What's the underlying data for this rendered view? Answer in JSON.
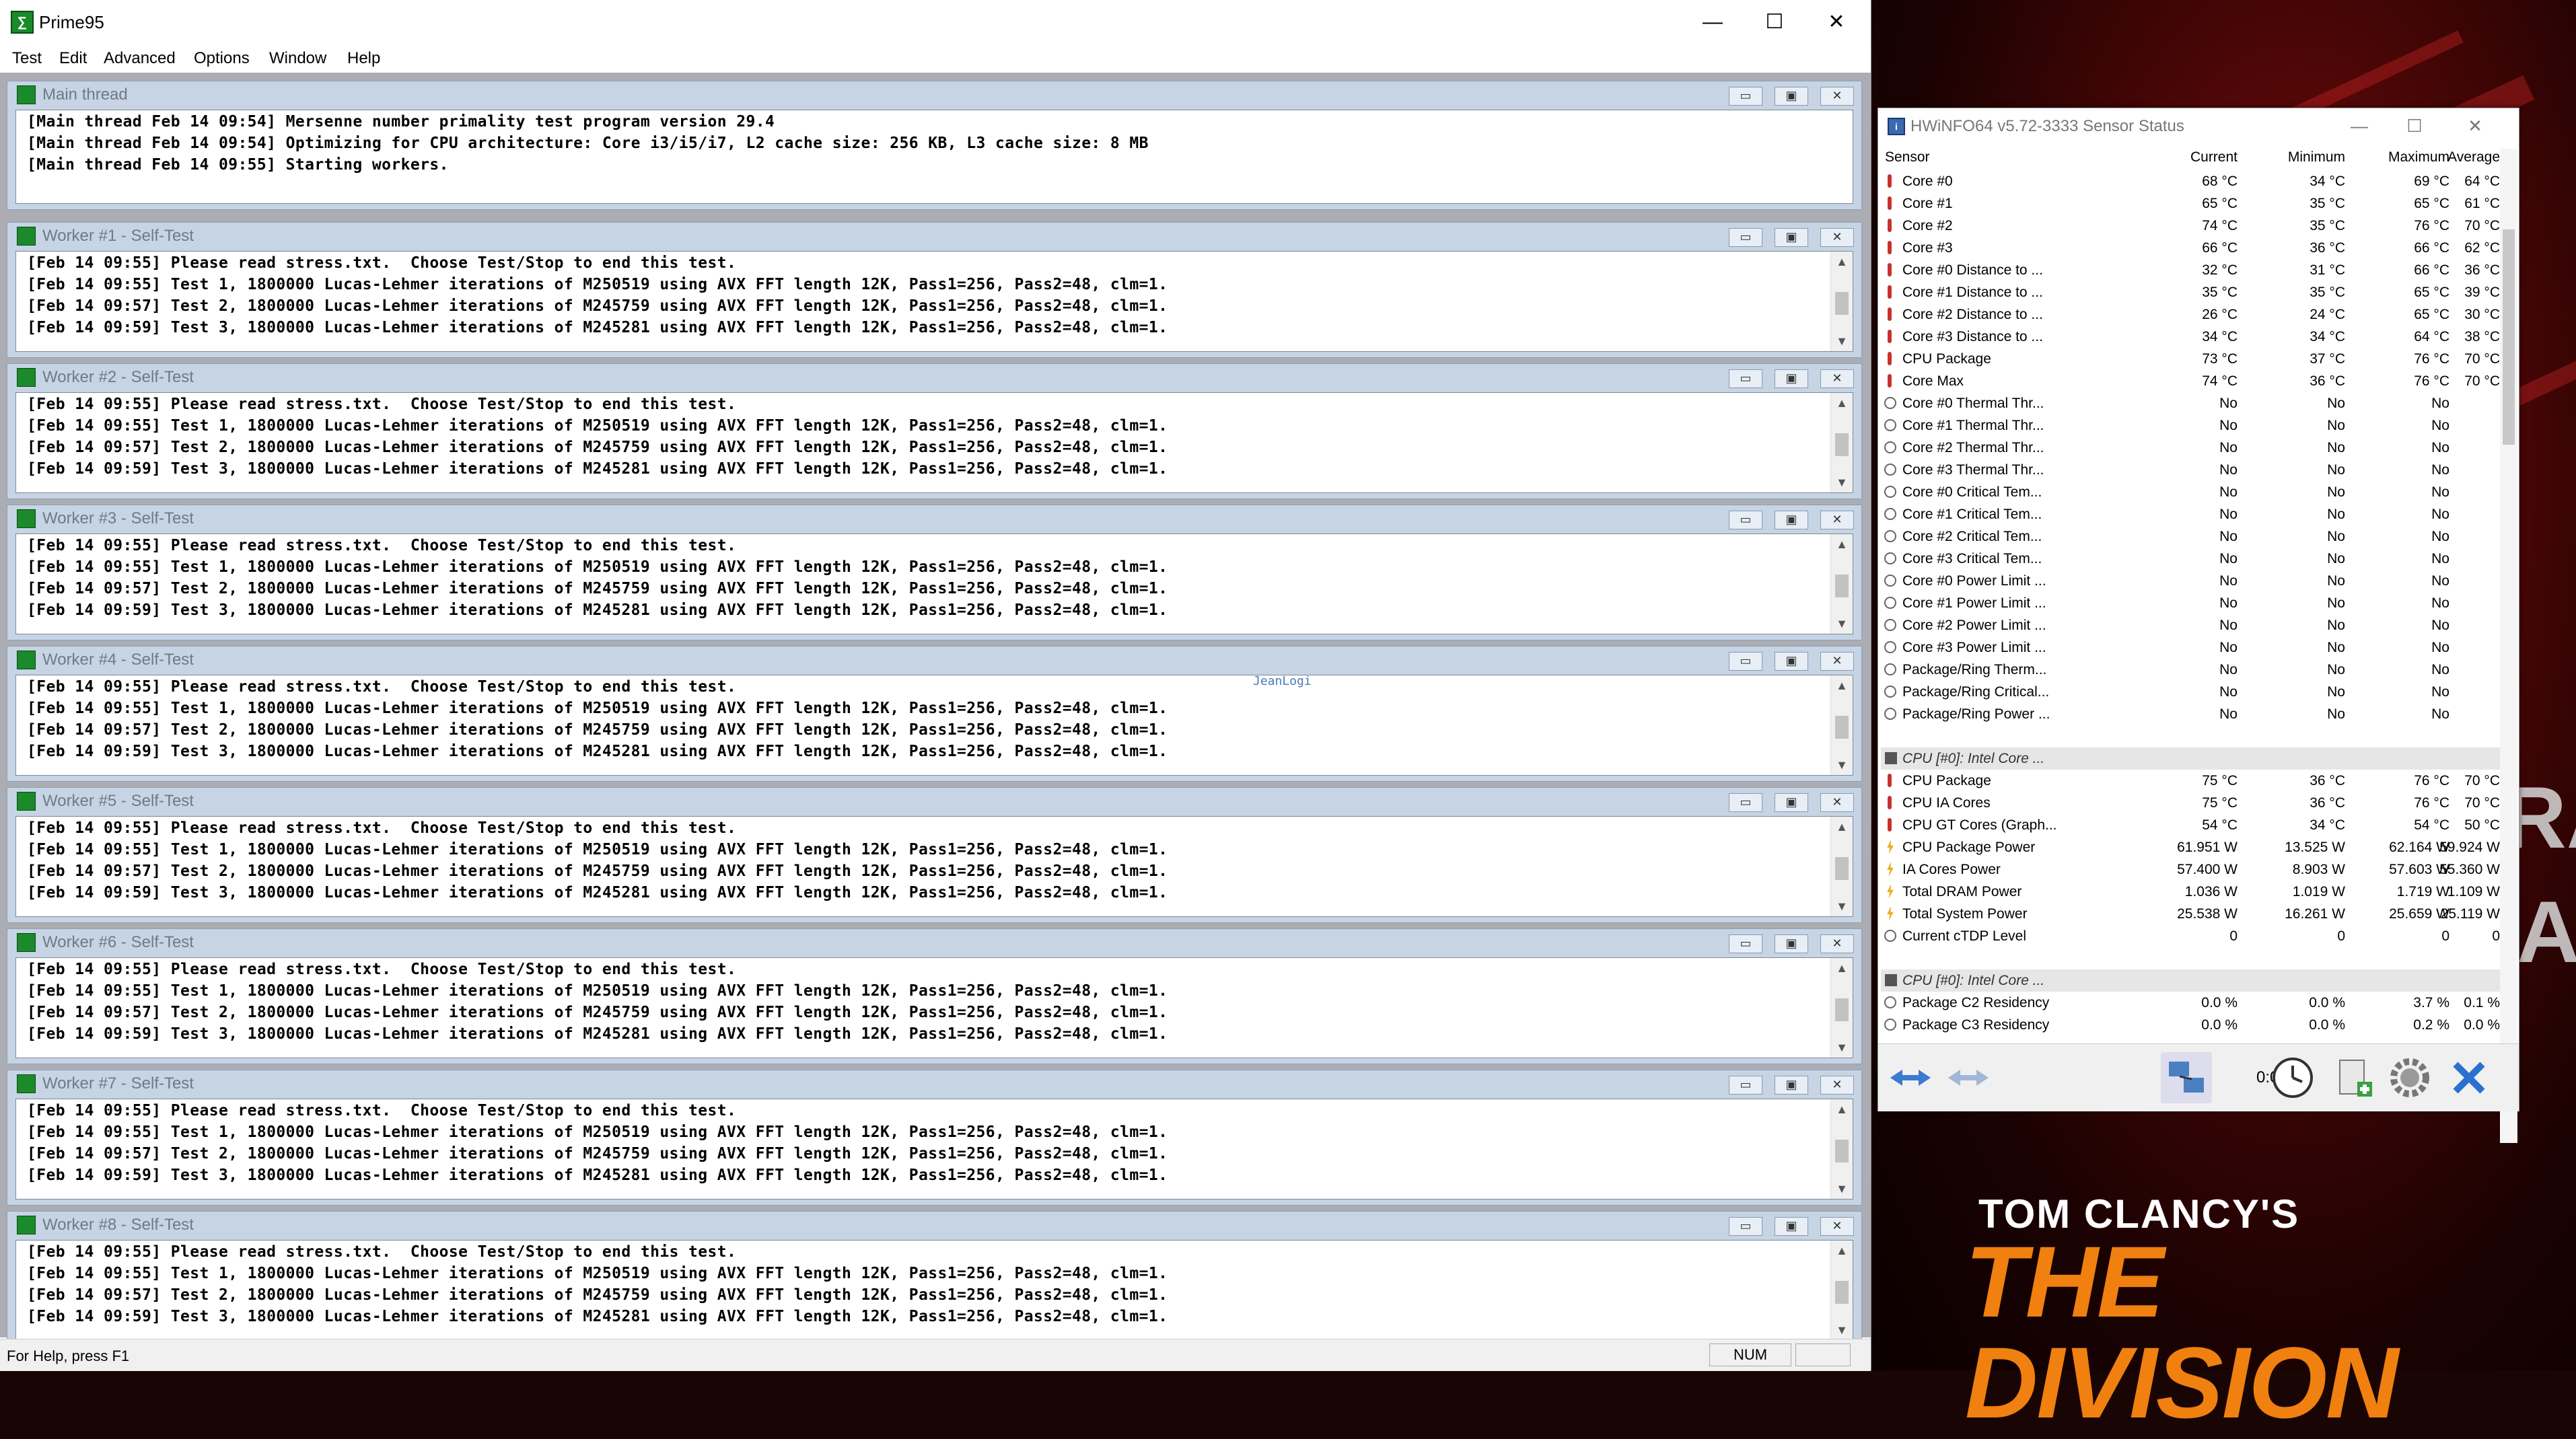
{
  "prime95": {
    "title": "Prime95",
    "menu": [
      "Test",
      "Edit",
      "Advanced",
      "Options",
      "Window",
      "Help"
    ],
    "main_thread": {
      "title": "Main thread",
      "lines": [
        "[Main thread Feb 14 09:54] Mersenne number primality test program version 29.4",
        "[Main thread Feb 14 09:54] Optimizing for CPU architecture: Core i3/i5/i7, L2 cache size: 256 KB, L3 cache size: 8 MB",
        "[Main thread Feb 14 09:55] Starting workers."
      ]
    },
    "workers": [
      {
        "title": "Worker #1 - Self-Test"
      },
      {
        "title": "Worker #2 - Self-Test"
      },
      {
        "title": "Worker #3 - Self-Test"
      },
      {
        "title": "Worker #4 - Self-Test"
      },
      {
        "title": "Worker #5 - Self-Test"
      },
      {
        "title": "Worker #6 - Self-Test"
      },
      {
        "title": "Worker #7 - Self-Test"
      },
      {
        "title": "Worker #8 - Self-Test"
      }
    ],
    "worker_lines": [
      "[Feb 14 09:55] Please read stress.txt.  Choose Test/Stop to end this test.",
      "[Feb 14 09:55] Test 1, 1800000 Lucas-Lehmer iterations of M250519 using AVX FFT length 12K, Pass1=256, Pass2=48, clm=1.",
      "[Feb 14 09:57] Test 2, 1800000 Lucas-Lehmer iterations of M245759 using AVX FFT length 12K, Pass1=256, Pass2=48, clm=1.",
      "[Feb 14 09:59] Test 3, 1800000 Lucas-Lehmer iterations of M245281 using AVX FFT length 12K, Pass1=256, Pass2=48, clm=1."
    ],
    "status_help": "For Help, press F1",
    "status_num": "NUM",
    "watermark": "JeanLogi"
  },
  "hwinfo": {
    "title": "HWiNFO64 v5.72-3333 Sensor Status",
    "columns": [
      "Sensor",
      "Current",
      "Minimum",
      "Maximum",
      "Average"
    ],
    "rows": [
      {
        "icon": "therm",
        "name": "Core #0",
        "cur": "68 °C",
        "min": "34 °C",
        "max": "69 °C",
        "avg": "64 °C"
      },
      {
        "icon": "therm",
        "name": "Core #1",
        "cur": "65 °C",
        "min": "35 °C",
        "max": "65 °C",
        "avg": "61 °C"
      },
      {
        "icon": "therm",
        "name": "Core #2",
        "cur": "74 °C",
        "min": "35 °C",
        "max": "76 °C",
        "avg": "70 °C"
      },
      {
        "icon": "therm",
        "name": "Core #3",
        "cur": "66 °C",
        "min": "36 °C",
        "max": "66 °C",
        "avg": "62 °C"
      },
      {
        "icon": "therm",
        "name": "Core #0 Distance to ...",
        "cur": "32 °C",
        "min": "31 °C",
        "max": "66 °C",
        "avg": "36 °C"
      },
      {
        "icon": "therm",
        "name": "Core #1 Distance to ...",
        "cur": "35 °C",
        "min": "35 °C",
        "max": "65 °C",
        "avg": "39 °C"
      },
      {
        "icon": "therm",
        "name": "Core #2 Distance to ...",
        "cur": "26 °C",
        "min": "24 °C",
        "max": "65 °C",
        "avg": "30 °C"
      },
      {
        "icon": "therm",
        "name": "Core #3 Distance to ...",
        "cur": "34 °C",
        "min": "34 °C",
        "max": "64 °C",
        "avg": "38 °C"
      },
      {
        "icon": "therm",
        "name": "CPU Package",
        "cur": "73 °C",
        "min": "37 °C",
        "max": "76 °C",
        "avg": "70 °C"
      },
      {
        "icon": "therm",
        "name": "Core Max",
        "cur": "74 °C",
        "min": "36 °C",
        "max": "76 °C",
        "avg": "70 °C"
      },
      {
        "icon": "circle",
        "name": "Core #0 Thermal Thr...",
        "cur": "No",
        "min": "No",
        "max": "No",
        "avg": ""
      },
      {
        "icon": "circle",
        "name": "Core #1 Thermal Thr...",
        "cur": "No",
        "min": "No",
        "max": "No",
        "avg": ""
      },
      {
        "icon": "circle",
        "name": "Core #2 Thermal Thr...",
        "cur": "No",
        "min": "No",
        "max": "No",
        "avg": ""
      },
      {
        "icon": "circle",
        "name": "Core #3 Thermal Thr...",
        "cur": "No",
        "min": "No",
        "max": "No",
        "avg": ""
      },
      {
        "icon": "circle",
        "name": "Core #0 Critical Tem...",
        "cur": "No",
        "min": "No",
        "max": "No",
        "avg": ""
      },
      {
        "icon": "circle",
        "name": "Core #1 Critical Tem...",
        "cur": "No",
        "min": "No",
        "max": "No",
        "avg": ""
      },
      {
        "icon": "circle",
        "name": "Core #2 Critical Tem...",
        "cur": "No",
        "min": "No",
        "max": "No",
        "avg": ""
      },
      {
        "icon": "circle",
        "name": "Core #3 Critical Tem...",
        "cur": "No",
        "min": "No",
        "max": "No",
        "avg": ""
      },
      {
        "icon": "circle",
        "name": "Core #0 Power Limit ...",
        "cur": "No",
        "min": "No",
        "max": "No",
        "avg": ""
      },
      {
        "icon": "circle",
        "name": "Core #1 Power Limit ...",
        "cur": "No",
        "min": "No",
        "max": "No",
        "avg": ""
      },
      {
        "icon": "circle",
        "name": "Core #2 Power Limit ...",
        "cur": "No",
        "min": "No",
        "max": "No",
        "avg": ""
      },
      {
        "icon": "circle",
        "name": "Core #3 Power Limit ...",
        "cur": "No",
        "min": "No",
        "max": "No",
        "avg": ""
      },
      {
        "icon": "circle",
        "name": "Package/Ring Therm...",
        "cur": "No",
        "min": "No",
        "max": "No",
        "avg": ""
      },
      {
        "icon": "circle",
        "name": "Package/Ring Critical...",
        "cur": "No",
        "min": "No",
        "max": "No",
        "avg": ""
      },
      {
        "icon": "circle",
        "name": "Package/Ring Power ...",
        "cur": "No",
        "min": "No",
        "max": "No",
        "avg": ""
      },
      {
        "icon": "blank",
        "name": "",
        "cur": "",
        "min": "",
        "max": "",
        "avg": ""
      },
      {
        "icon": "chip",
        "name": "CPU [#0]: Intel Core ...",
        "cur": "",
        "min": "",
        "max": "",
        "avg": "",
        "group": true
      },
      {
        "icon": "therm",
        "name": "CPU Package",
        "cur": "75 °C",
        "min": "36 °C",
        "max": "76 °C",
        "avg": "70 °C"
      },
      {
        "icon": "therm",
        "name": "CPU IA Cores",
        "cur": "75 °C",
        "min": "36 °C",
        "max": "76 °C",
        "avg": "70 °C"
      },
      {
        "icon": "therm",
        "name": "CPU GT Cores (Graph...",
        "cur": "54 °C",
        "min": "34 °C",
        "max": "54 °C",
        "avg": "50 °C"
      },
      {
        "icon": "power",
        "name": "CPU Package Power",
        "cur": "61.951 W",
        "min": "13.525 W",
        "max": "62.164 W",
        "avg": "59.924 W"
      },
      {
        "icon": "power",
        "name": "IA Cores Power",
        "cur": "57.400 W",
        "min": "8.903 W",
        "max": "57.603 W",
        "avg": "55.360 W"
      },
      {
        "icon": "power",
        "name": "Total DRAM Power",
        "cur": "1.036 W",
        "min": "1.019 W",
        "max": "1.719 W",
        "avg": "1.109 W"
      },
      {
        "icon": "power",
        "name": "Total System Power",
        "cur": "25.538 W",
        "min": "16.261 W",
        "max": "25.659 W",
        "avg": "25.119 W"
      },
      {
        "icon": "circle",
        "name": "Current cTDP Level",
        "cur": "0",
        "min": "0",
        "max": "0",
        "avg": "0"
      },
      {
        "icon": "blank",
        "name": "",
        "cur": "",
        "min": "",
        "max": "",
        "avg": ""
      },
      {
        "icon": "chip",
        "name": "CPU [#0]: Intel Core ...",
        "cur": "",
        "min": "",
        "max": "",
        "avg": "",
        "group": true
      },
      {
        "icon": "circle",
        "name": "Package C2 Residency",
        "cur": "0.0 %",
        "min": "0.0 %",
        "max": "3.7 %",
        "avg": "0.1 %"
      },
      {
        "icon": "circle",
        "name": "Package C3 Residency",
        "cur": "0.0 %",
        "min": "0.0 %",
        "max": "0.2 %",
        "avg": "0.0 %"
      }
    ],
    "timer": "0:05:07"
  },
  "wallpaper": {
    "line1": "TOM CLANCY'S",
    "line2": "THE DIVISION",
    "side1": "RA",
    "side2": "AR"
  }
}
